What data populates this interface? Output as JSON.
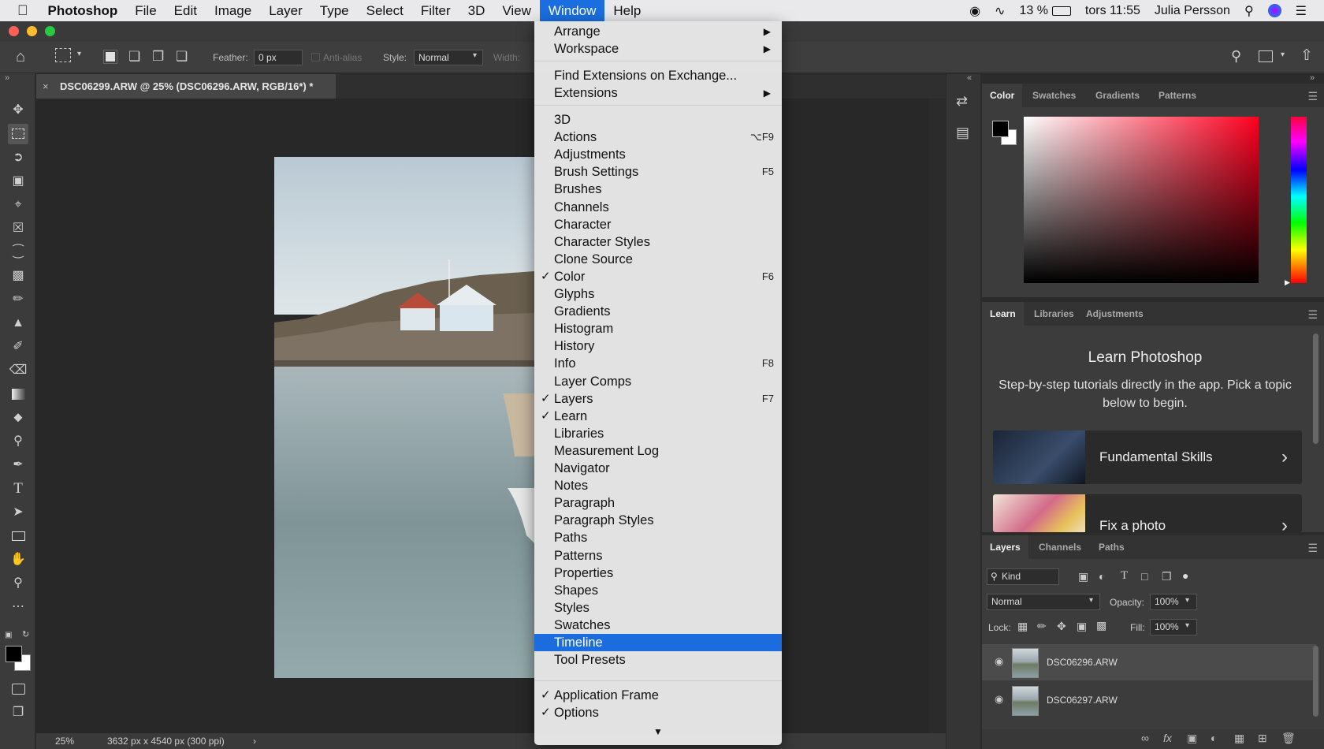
{
  "menubar": {
    "apple_icon": "apple-icon",
    "items": [
      "Photoshop",
      "File",
      "Edit",
      "Image",
      "Layer",
      "Type",
      "Select",
      "Filter",
      "3D",
      "View",
      "Window",
      "Help"
    ],
    "active": "Window",
    "battery": "13 %",
    "clock": "tors 11:55",
    "user": "Julia Persson"
  },
  "options": {
    "feather_label": "Feather:",
    "feather_value": "0 px",
    "antialias_label": "Anti-alias",
    "style_label": "Style:",
    "style_value": "Normal",
    "width_label": "Width:"
  },
  "document": {
    "tab_title": "DSC06299.ARW @ 25% (DSC06296.ARW, RGB/16*) *",
    "zoom": "25%",
    "info": "3632 px x 4540 px (300 ppi)"
  },
  "window_menu": {
    "group1": [
      {
        "label": "Arrange",
        "submenu": true
      },
      {
        "label": "Workspace",
        "submenu": true
      }
    ],
    "group2": [
      {
        "label": "Find Extensions on Exchange...",
        "submenu": false
      },
      {
        "label": "Extensions",
        "submenu": true
      }
    ],
    "group3": [
      {
        "label": "3D",
        "shortcut": "",
        "checked": false
      },
      {
        "label": "Actions",
        "shortcut": "⌥F9",
        "checked": false
      },
      {
        "label": "Adjustments",
        "shortcut": "",
        "checked": false
      },
      {
        "label": "Brush Settings",
        "shortcut": "F5",
        "checked": false
      },
      {
        "label": "Brushes",
        "shortcut": "",
        "checked": false
      },
      {
        "label": "Channels",
        "shortcut": "",
        "checked": false
      },
      {
        "label": "Character",
        "shortcut": "",
        "checked": false
      },
      {
        "label": "Character Styles",
        "shortcut": "",
        "checked": false
      },
      {
        "label": "Clone Source",
        "shortcut": "",
        "checked": false
      },
      {
        "label": "Color",
        "shortcut": "F6",
        "checked": true
      },
      {
        "label": "Glyphs",
        "shortcut": "",
        "checked": false
      },
      {
        "label": "Gradients",
        "shortcut": "",
        "checked": false
      },
      {
        "label": "Histogram",
        "shortcut": "",
        "checked": false
      },
      {
        "label": "History",
        "shortcut": "",
        "checked": false
      },
      {
        "label": "Info",
        "shortcut": "F8",
        "checked": false
      },
      {
        "label": "Layer Comps",
        "shortcut": "",
        "checked": false
      },
      {
        "label": "Layers",
        "shortcut": "F7",
        "checked": true
      },
      {
        "label": "Learn",
        "shortcut": "",
        "checked": true
      },
      {
        "label": "Libraries",
        "shortcut": "",
        "checked": false
      },
      {
        "label": "Measurement Log",
        "shortcut": "",
        "checked": false
      },
      {
        "label": "Navigator",
        "shortcut": "",
        "checked": false
      },
      {
        "label": "Notes",
        "shortcut": "",
        "checked": false
      },
      {
        "label": "Paragraph",
        "shortcut": "",
        "checked": false
      },
      {
        "label": "Paragraph Styles",
        "shortcut": "",
        "checked": false
      },
      {
        "label": "Paths",
        "shortcut": "",
        "checked": false
      },
      {
        "label": "Patterns",
        "shortcut": "",
        "checked": false
      },
      {
        "label": "Properties",
        "shortcut": "",
        "checked": false
      },
      {
        "label": "Shapes",
        "shortcut": "",
        "checked": false
      },
      {
        "label": "Styles",
        "shortcut": "",
        "checked": false
      },
      {
        "label": "Swatches",
        "shortcut": "",
        "checked": false
      },
      {
        "label": "Timeline",
        "shortcut": "",
        "checked": false,
        "selected": true
      },
      {
        "label": "Tool Presets",
        "shortcut": "",
        "checked": false
      }
    ],
    "group4": [
      {
        "label": "Application Frame",
        "checked": true
      },
      {
        "label": "Options",
        "checked": true
      }
    ],
    "scroll_arrow": "▼"
  },
  "color_panel": {
    "tabs": [
      "Color",
      "Swatches",
      "Gradients",
      "Patterns"
    ],
    "active": "Color"
  },
  "learn_panel": {
    "tabs": [
      "Learn",
      "Libraries",
      "Adjustments"
    ],
    "active": "Learn",
    "title": "Learn Photoshop",
    "description": "Step-by-step tutorials directly in the app. Pick a topic below to begin.",
    "cards": [
      "Fundamental Skills",
      "Fix a photo"
    ]
  },
  "layers_panel": {
    "tabs": [
      "Layers",
      "Channels",
      "Paths"
    ],
    "active": "Layers",
    "filter_kind": "Kind",
    "blend_mode": "Normal",
    "opacity_label": "Opacity:",
    "opacity_value": "100%",
    "lock_label": "Lock:",
    "fill_label": "Fill:",
    "fill_value": "100%",
    "layers": [
      "DSC06296.ARW",
      "DSC06297.ARW"
    ]
  },
  "colors": {
    "accent": "#1b6cde",
    "menu_bg": "#e8e8e8",
    "panel_bg": "#3c3c3c"
  }
}
